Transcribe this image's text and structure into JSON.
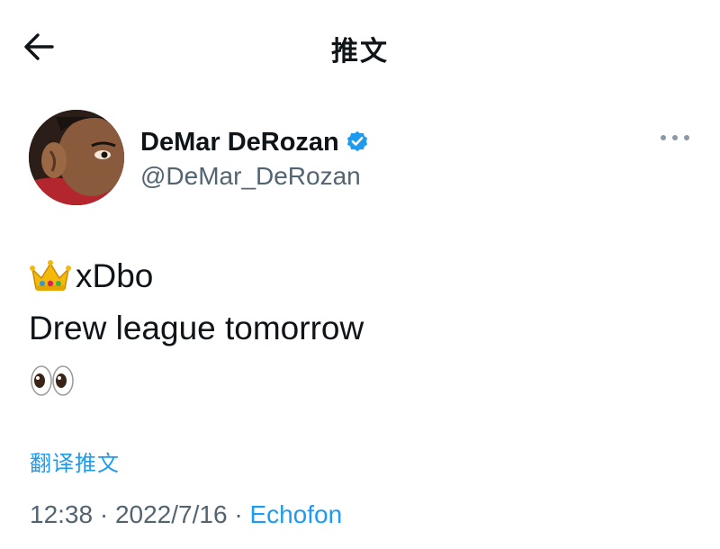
{
  "header": {
    "title": "推文",
    "back_icon": "arrow-left-icon"
  },
  "author": {
    "display_name": "DeMar DeRozan",
    "handle": "@DeMar_DeRozan",
    "verified_icon": "verified-badge-icon",
    "verified_color": "#1d9bf0"
  },
  "tweet": {
    "line1_text": "xDbo",
    "line1_icon": "crown-emoji-icon",
    "line2_text": "Drew league tomorrow",
    "line3_icon": "eyes-emoji-icon"
  },
  "translate_label": "翻译推文",
  "meta": {
    "time": "12:38",
    "separator": "·",
    "date": "2022/7/16",
    "source": "Echofon"
  },
  "colors": {
    "link": "#1d9bf0",
    "secondary_text": "#536471",
    "text": "#0f1419"
  }
}
